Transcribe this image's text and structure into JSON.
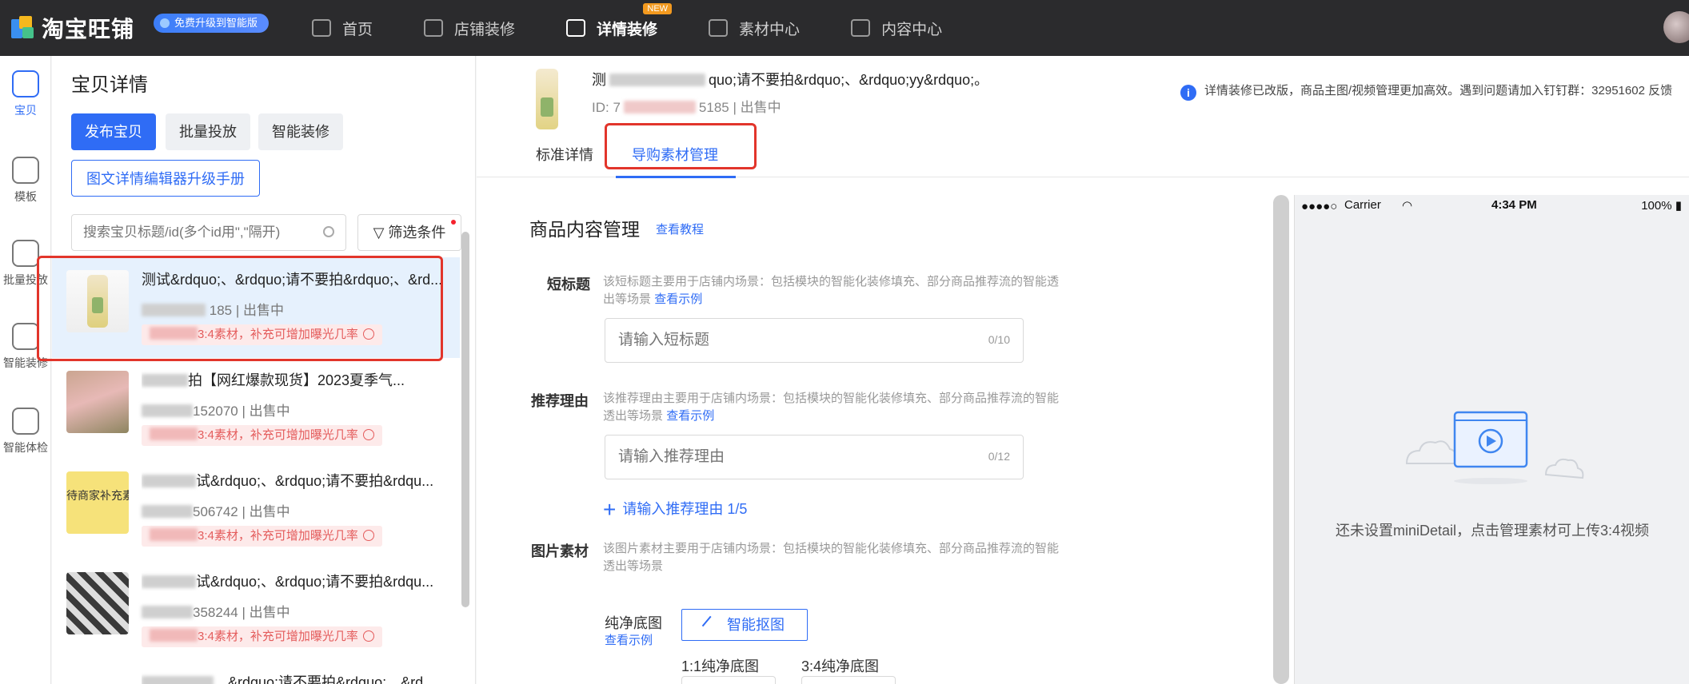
{
  "topbar": {
    "logo_text": "淘宝旺铺",
    "upgrade_pill": "免费升级到智能版",
    "nav": [
      {
        "label": "首页",
        "icon": "home-icon"
      },
      {
        "label": "店铺装修",
        "icon": "store-icon"
      },
      {
        "label": "详情装修",
        "icon": "detail-icon",
        "badge": "NEW"
      },
      {
        "label": "素材中心",
        "icon": "folder-icon"
      },
      {
        "label": "内容中心",
        "icon": "video-icon"
      }
    ]
  },
  "rail": [
    {
      "label": "宝贝",
      "icon": "bag-icon",
      "active": true
    },
    {
      "label": "模板",
      "icon": "template-icon"
    },
    {
      "label": "批量投放",
      "icon": "batch-icon"
    },
    {
      "label": "智能装修",
      "icon": "roller-icon"
    },
    {
      "label": "智能体检",
      "icon": "pulse-icon"
    }
  ],
  "list_panel": {
    "title": "宝贝详情",
    "buttons": {
      "publish": "发布宝贝",
      "batch": "批量投放",
      "smart": "智能装修",
      "manual": "图文详情编辑器升级手册"
    },
    "search_placeholder": "搜索宝贝标题/id(多个id用\",\"隔开)",
    "filter_label": "筛选条件",
    "items": [
      {
        "title": "测试&rdquo;、&rdquo;请不要拍&rdquo;、&rd...",
        "meta": "185 | 出售中",
        "tip": "3:4素材，补充可增加曝光几率"
      },
      {
        "title": "拍【网红爆款现货】2023夏季气...",
        "meta": "152070 | 出售中",
        "tip": "3:4素材，补充可增加曝光几率"
      },
      {
        "title": "试&rdquo;、&rdquo;请不要拍&rdqu...",
        "meta": "506742 | 出售中",
        "tip": "3:4素材，补充可增加曝光几率",
        "thumb_text": "待商家补充素"
      },
      {
        "title": "试&rdquo;、&rdquo;请不要拍&rdqu...",
        "meta": "358244 | 出售中",
        "tip": "3:4素材，补充可增加曝光几率"
      },
      {
        "title": "、&rdquo;请不要拍&rdquo;、&rd...",
        "meta": "",
        "tip": ""
      }
    ]
  },
  "product": {
    "title": "quo;请不要拍&rdquo;、&rdquo;yy&rdquo;。",
    "title_prefix": "测",
    "id_prefix": "ID: 7",
    "id_suffix": "5185 | 出售中"
  },
  "notice": "详情装修已改版，商品主图/视频管理更加高效。遇到问题请加入钉钉群：32951602 反馈",
  "tabs": {
    "standard": "标准详情",
    "guide": "导购素材管理"
  },
  "content": {
    "section_title": "商品内容管理",
    "section_link": "查看教程",
    "short_title": {
      "label": "短标题",
      "desc": "该短标题主要用于店铺内场景：包括模块的智能化装修填充、部分商品推荐流的智能透出等场景",
      "link": "查看示例",
      "placeholder": "请输入短标题",
      "count": "0/10"
    },
    "reason": {
      "label": "推荐理由",
      "desc": "该推荐理由主要用于店铺内场景：包括模块的智能化装修填充、部分商品推荐流的智能透出等场景",
      "link": "查看示例",
      "placeholder": "请输入推荐理由",
      "count": "0/12",
      "add_label": "请输入推荐理由 1/5"
    },
    "image": {
      "label": "图片素材",
      "desc": "该图片素材主要用于店铺内场景：包括模块的智能化装修填充、部分商品推荐流的智能透出等场景",
      "pure_label": "纯净底图",
      "pure_link": "查看示例",
      "ai_button": "智能抠图",
      "ratio_11": "1:1纯净底图",
      "ratio_34": "3:4纯净底图"
    }
  },
  "preview": {
    "carrier": "Carrier",
    "time": "4:34 PM",
    "battery": "100%",
    "empty_text": "还未设置miniDetail，点击管理素材可上传3:4视频"
  }
}
